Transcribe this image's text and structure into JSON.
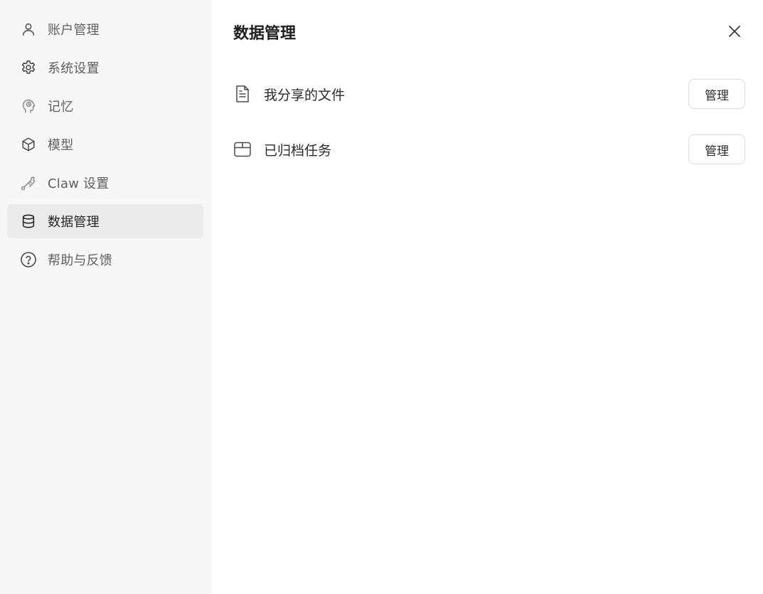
{
  "sidebar": {
    "items": [
      {
        "label": "账户管理",
        "icon": "user-icon"
      },
      {
        "label": "系统设置",
        "icon": "gear-icon"
      },
      {
        "label": "记忆",
        "icon": "memory-head-icon"
      },
      {
        "label": "模型",
        "icon": "cube-icon"
      },
      {
        "label": "Claw 设置",
        "icon": "claw-tool-icon"
      },
      {
        "label": "数据管理",
        "icon": "database-icon",
        "active": true
      },
      {
        "label": "帮助与反馈",
        "icon": "help-circle-icon"
      }
    ]
  },
  "main": {
    "title": "数据管理",
    "rows": [
      {
        "label": "我分享的文件",
        "icon": "document-icon",
        "button": "管理"
      },
      {
        "label": "已归档任务",
        "icon": "archive-box-icon",
        "button": "管理"
      }
    ]
  },
  "colors": {
    "sidebar_bg": "#f7f7f7",
    "active_bg": "#ebebeb",
    "text_primary": "#262626",
    "text_secondary": "#5f5f5f"
  }
}
